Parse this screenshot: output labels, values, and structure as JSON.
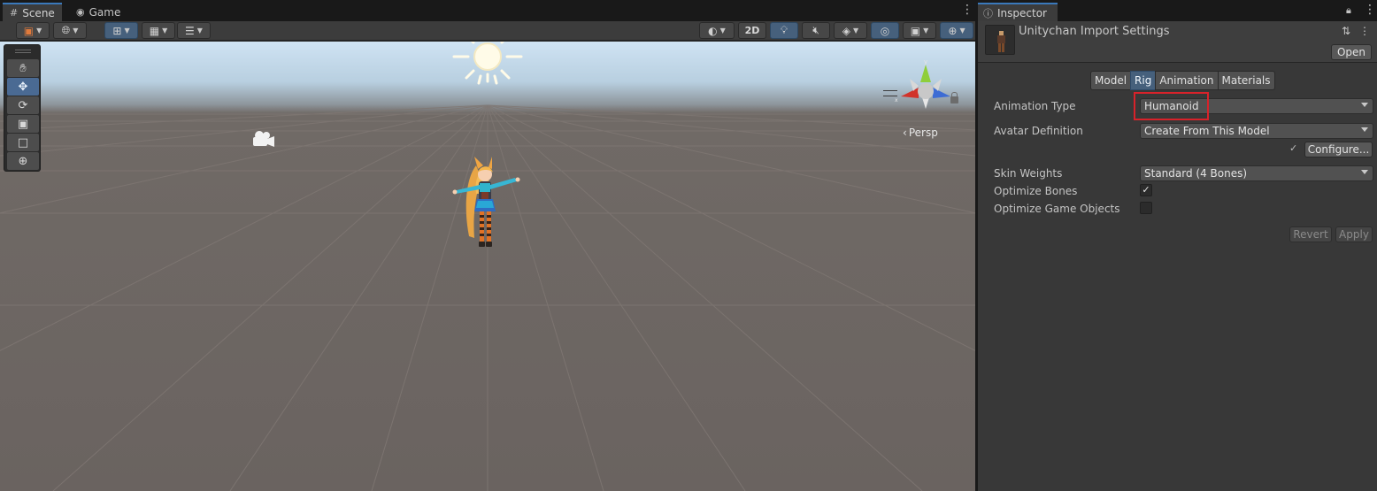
{
  "scene": {
    "tabs": [
      {
        "label": "Scene",
        "icon": "grid-icon"
      },
      {
        "label": "Game",
        "icon": "gamepad-icon"
      }
    ],
    "toolbar": {
      "mode_2d_label": "2D"
    },
    "view_label": "Persp",
    "tools": [
      "hand-tool",
      "move-tool",
      "rotate-tool",
      "scale-tool",
      "rect-tool",
      "transform-tool"
    ],
    "active_tool": "move-tool",
    "sky_color": "#cfe3f3",
    "ground_color": "#6a6360"
  },
  "inspector": {
    "tab_label": "Inspector",
    "asset_title": "Unitychan Import Settings",
    "open_label": "Open",
    "subtabs": [
      {
        "label": "Model",
        "active": false
      },
      {
        "label": "Rig",
        "active": true
      },
      {
        "label": "Animation",
        "active": false
      },
      {
        "label": "Materials",
        "active": false
      }
    ],
    "fields": {
      "animation_type": {
        "label": "Animation Type",
        "value": "Humanoid"
      },
      "avatar_definition": {
        "label": "Avatar Definition",
        "value": "Create From This Model"
      },
      "configure_label": "Configure...",
      "skin_weights": {
        "label": "Skin Weights",
        "value": "Standard (4 Bones)"
      },
      "optimize_bones": {
        "label": "Optimize Bones",
        "checked": true
      },
      "optimize_game_objects": {
        "label": "Optimize Game Objects",
        "checked": false
      }
    },
    "revert_label": "Revert",
    "apply_label": "Apply",
    "highlight_color": "#d8222a",
    "accent_color": "#46607c"
  }
}
